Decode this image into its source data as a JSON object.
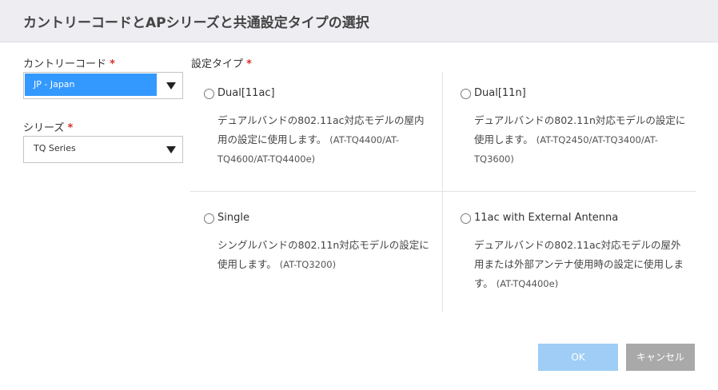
{
  "dialog": {
    "title": "カントリーコードとAPシリーズと共通設定タイプの選択"
  },
  "country": {
    "label": "カントリーコード",
    "required_mark": "*",
    "value": "JP - Japan"
  },
  "series": {
    "label": "シリーズ",
    "required_mark": "*",
    "value": "TQ Series"
  },
  "setting_type": {
    "label": "設定タイプ",
    "required_mark": "*",
    "options": [
      {
        "name": "Dual[11ac]",
        "description": "デュアルバンドの802.11ac対応モデルの屋内用の設定に使用します。",
        "models": "(AT-TQ4400/AT-TQ4600/AT-TQ4400e)",
        "selected": false
      },
      {
        "name": "Dual[11n]",
        "description": "デュアルバンドの802.11n対応モデルの設定に使用します。",
        "models": "(AT-TQ2450/AT-TQ3400/AT-TQ3600)",
        "selected": false
      },
      {
        "name": "Single",
        "description": "シングルバンドの802.11n対応モデルの設定に使用します。",
        "models": "(AT-TQ3200)",
        "selected": false
      },
      {
        "name": "11ac with External Antenna",
        "description": "デュアルバンドの802.11ac対応モデルの屋外用または外部アンテナ使用時の設定に使用します。",
        "models": "(AT-TQ4400e)",
        "selected": false
      }
    ]
  },
  "buttons": {
    "ok": "OK",
    "cancel": "キャンセル"
  },
  "colors": {
    "selection_highlight": "#3399ff",
    "required": "#d9302c",
    "ok_button_disabled": "#9fcdf5",
    "cancel_button": "#a9a9a9",
    "header_bg": "#eeeef2"
  }
}
